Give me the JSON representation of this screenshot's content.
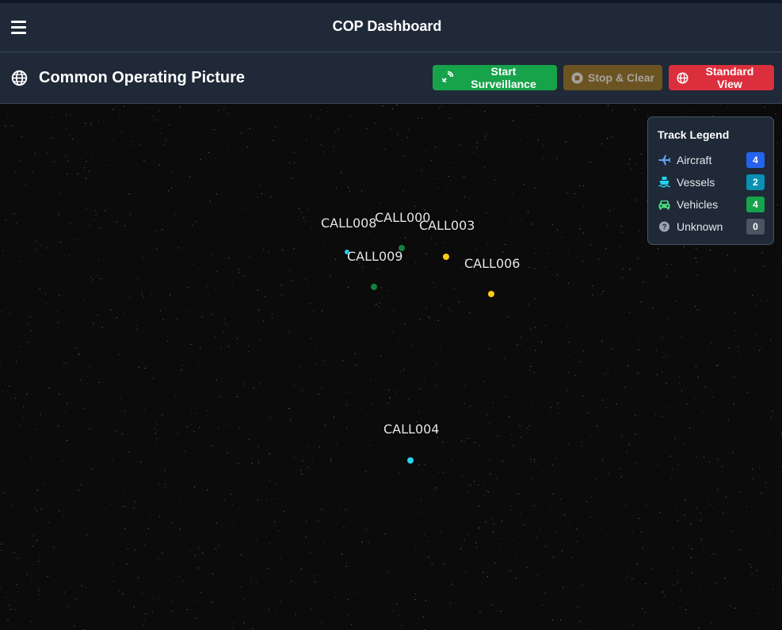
{
  "header": {
    "app_title": "COP Dashboard"
  },
  "toolbar": {
    "page_title": "Common Operating Picture",
    "start_label": "Start Surveillance",
    "stop_label": "Stop & Clear",
    "standard_label": "Standard View"
  },
  "colors": {
    "header_bg": "#1f2937",
    "start_bg": "#16a34a",
    "stop_bg": "#6b5421",
    "standard_bg": "#dc2f3d",
    "aircraft_badge": "#2563eb",
    "vessels_badge": "#0891b2",
    "vehicles_badge": "#16a34a",
    "unknown_badge": "#4b5563"
  },
  "map": {
    "tracks": [
      {
        "callsign": "CALL008",
        "color": "#22d3ee"
      },
      {
        "callsign": "CALL000",
        "color": "#15803d"
      },
      {
        "callsign": "CALL003",
        "color": "#facc15"
      },
      {
        "callsign": "CALL009",
        "color": "#15803d"
      },
      {
        "callsign": "CALL006",
        "color": "#facc15"
      },
      {
        "callsign": "CALL004",
        "color": "#22d3ee"
      }
    ]
  },
  "legend": {
    "title": "Track Legend",
    "items": [
      {
        "label": "Aircraft",
        "count": "4",
        "icon": "plane-icon"
      },
      {
        "label": "Vessels",
        "count": "2",
        "icon": "ship-icon"
      },
      {
        "label": "Vehicles",
        "count": "4",
        "icon": "car-icon"
      },
      {
        "label": "Unknown",
        "count": "0",
        "icon": "question-icon"
      }
    ]
  }
}
